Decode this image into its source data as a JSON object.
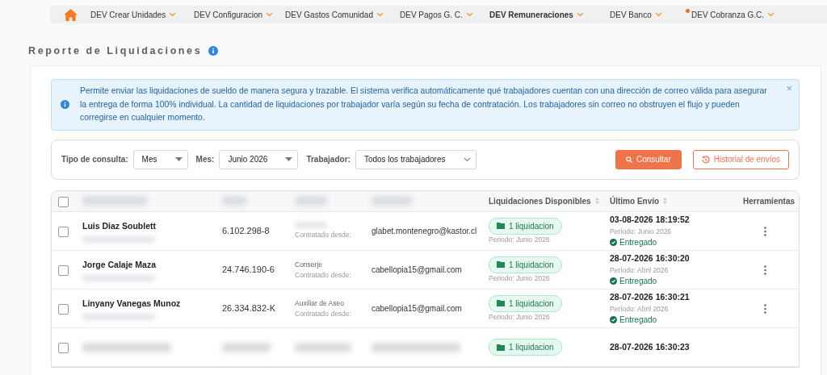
{
  "nav": {
    "items": [
      {
        "label": "DEV Crear Unidades",
        "selected": false,
        "alert": false
      },
      {
        "label": "DEV Configuracion",
        "selected": false,
        "alert": false
      },
      {
        "label": "DEV Gastos Comunidad",
        "selected": false,
        "alert": false
      },
      {
        "label": "DEV Pagos G. C.",
        "selected": false,
        "alert": false
      },
      {
        "label": "DEV Remuneraciones",
        "selected": true,
        "alert": false
      },
      {
        "label": "DEV Banco",
        "selected": false,
        "alert": false
      },
      {
        "label": "DEV Cobranza G.C.",
        "selected": false,
        "alert": true
      }
    ]
  },
  "page_title": "Reporte de Liquidaciones",
  "alert": {
    "text": "Permite enviar las liquidaciones de sueldo de manera segura y trazable. El sistema verifica automáticamente qué trabajadores cuentan con una dirección de correo válida para asegurar la entrega de forma 100% individual. La cantidad de liquidaciones por trabajador varía según su fecha de contratación. Los trabajadores sin correo no obstruyen el flujo y pueden corregirse en cualquier momento.",
    "close": "×"
  },
  "filters": [
    {
      "label": "Tipo de consulta:",
      "value": "Mes",
      "kind": "select"
    },
    {
      "label": "Mes:",
      "value": "Junio 2026",
      "kind": "select"
    },
    {
      "label": "Trabajador:",
      "value": "Todos los trabajadores",
      "kind": "chevron"
    }
  ],
  "buttons": [
    {
      "label": "Consultar",
      "kind": "primary"
    },
    {
      "label": "Historial de envíos",
      "kind": "outline"
    }
  ],
  "table": {
    "header_checked": false,
    "columns": [
      {
        "kind": "blurred"
      },
      {
        "kind": "blurred"
      },
      {
        "kind": "blurred"
      },
      {
        "kind": "blurred"
      },
      {
        "kind": "text",
        "label": "Liquidaciones Disponibles",
        "sortable": true
      },
      {
        "kind": "text",
        "label": "Último Envío",
        "sortable": true
      },
      {
        "kind": "text",
        "label": "Herramientas",
        "sortable": false
      }
    ],
    "rows": [
      {
        "checked": false,
        "name": "Luis Diaz Soublett",
        "rut": "6.102.298-8",
        "hired_label": "Contratado desde:",
        "email": "glabet.montenegro@kastor.cl",
        "count": "1 liquidacion",
        "period": "Periodo: Junio 2026",
        "sent": "03-08-2026 18:19:52",
        "sent_period": "Período: Junio 2026",
        "status": "Entregado"
      },
      {
        "checked": false,
        "name": "Jorge Calaje Maza",
        "rut": "24.746.190-6",
        "cargo": "Conserje",
        "hired_label": "Contratado desde:",
        "email": "cabellopia15@gmail.com",
        "count": "1 liquidacion",
        "period": "Periodo: Junio 2026",
        "sent": "28-07-2026 16:30:20",
        "sent_period": "Período: Abril 2026",
        "status": "Entregado"
      },
      {
        "checked": false,
        "name": "Linyany Vanegas Munoz",
        "rut": "26.334.832-K",
        "cargo": "Auxiliar de Aseo",
        "hired_label": "Contratado desde:",
        "email": "cabellopia15@gmail.com",
        "count": "1 liquidacion",
        "period": "Periodo: Junio 2026",
        "sent": "28-07-2026 16:30:21",
        "sent_period": "Período: Abril 2026",
        "status": "Entregado"
      },
      {
        "checked": false,
        "count": "1 liquidacion",
        "sent": "28-07-2026 16:30:23"
      }
    ]
  }
}
